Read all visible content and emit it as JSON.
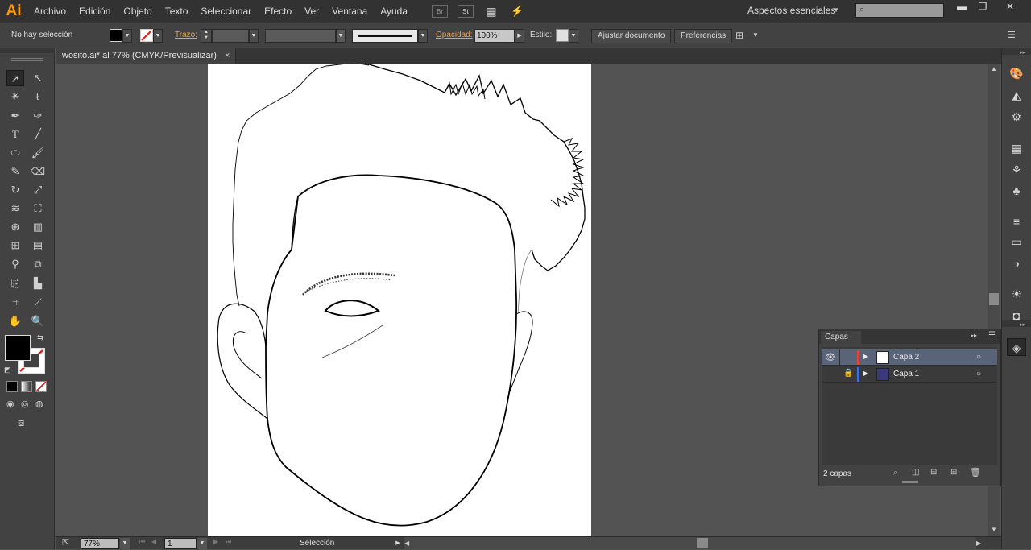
{
  "app": {
    "logo": "Ai"
  },
  "menu": [
    "Archivo",
    "Edición",
    "Objeto",
    "Texto",
    "Seleccionar",
    "Efecto",
    "Ver",
    "Ventana",
    "Ayuda"
  ],
  "menubar_icons": {
    "bridge": "Br",
    "stock": "St"
  },
  "workspace": "Aspectos esenciales",
  "control": {
    "selection_status": "No hay selección",
    "stroke_label": "Trazo:",
    "opacity_label": "Opacidad:",
    "opacity_value": "100%",
    "style_label": "Estilo:",
    "fit_document": "Ajustar documento",
    "preferences": "Preferencias"
  },
  "document": {
    "tab_title": "wosito.ai* al 77% (CMYK/Previsualizar)",
    "close": "×"
  },
  "status": {
    "zoom": "77%",
    "artboard": "1",
    "tool": "Selección"
  },
  "layers_panel": {
    "title": "Capas",
    "layers": [
      {
        "name": "Capa 2",
        "color": "#e0463a",
        "selected": true
      },
      {
        "name": "Capa 1",
        "color": "#3f6fe0",
        "selected": false
      }
    ],
    "count": "2 capas"
  },
  "colors": {
    "fill": "#000000",
    "accent": "#ff9a00"
  }
}
